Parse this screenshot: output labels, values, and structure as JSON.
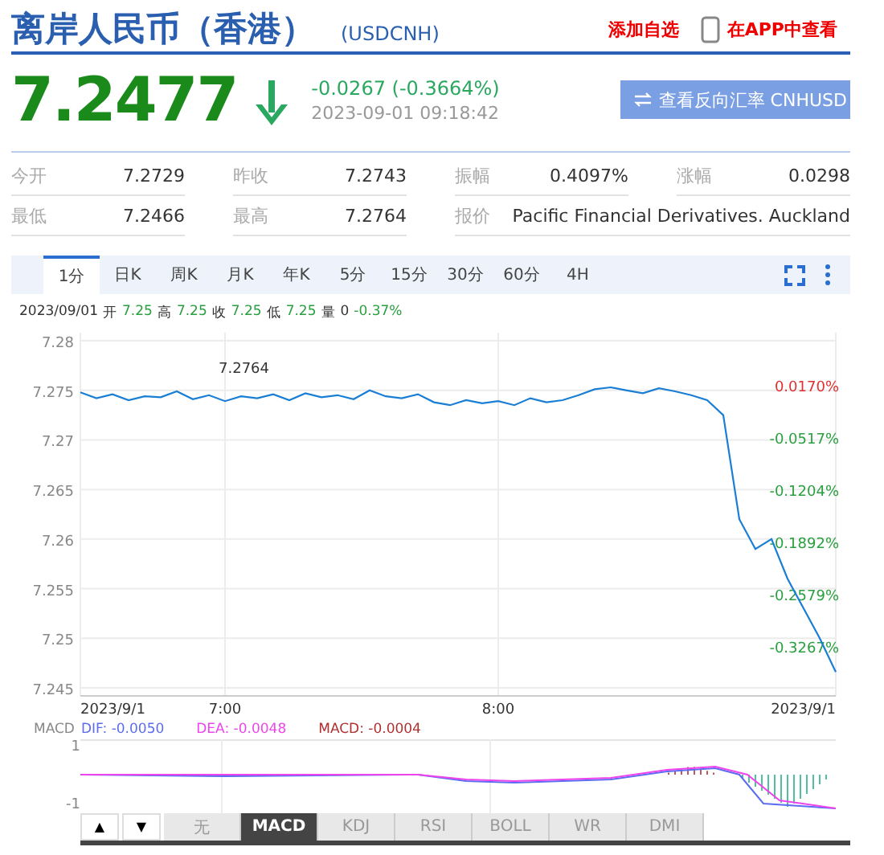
{
  "header": {
    "title": "离岸人民币（香港）",
    "code": "(USDCNH)",
    "add_watch": "添加自选",
    "app_link": "在APP中查看"
  },
  "quote": {
    "price": "7.2477",
    "change": "-0.0267 (-0.3664%)",
    "time": "2023-09-01 09:18:42",
    "reverse_button": "查看反向汇率 CNHUSD"
  },
  "stats": [
    [
      {
        "label": "今开",
        "value": "7.2729"
      },
      {
        "label": "昨收",
        "value": "7.2743"
      },
      {
        "label": "振幅",
        "value": "0.4097%"
      },
      {
        "label": "涨幅",
        "value": "0.0298"
      }
    ],
    [
      {
        "label": "最低",
        "value": "7.2466"
      },
      {
        "label": "最高",
        "value": "7.2764"
      },
      {
        "label": "报价",
        "value": "Pacific Financial Derivatives. Auckland"
      }
    ]
  ],
  "periods": [
    {
      "label": "1分",
      "selected": true
    },
    {
      "label": "日K",
      "selected": false
    },
    {
      "label": "周K",
      "selected": false
    },
    {
      "label": "月K",
      "selected": false
    },
    {
      "label": "年K",
      "selected": false
    },
    {
      "label": "5分",
      "selected": false
    },
    {
      "label": "15分",
      "selected": false
    },
    {
      "label": "30分",
      "selected": false
    },
    {
      "label": "60分",
      "selected": false
    },
    {
      "label": "4H",
      "selected": false
    }
  ],
  "chart": {
    "info": {
      "date": "2023/09/01",
      "fields": [
        {
          "label": "开",
          "value": "7.25"
        },
        {
          "label": "高",
          "value": "7.25"
        },
        {
          "label": "收",
          "value": "7.25"
        },
        {
          "label": "低",
          "value": "7.25"
        },
        {
          "label": "量",
          "value": "0"
        }
      ],
      "change": "-0.37%"
    },
    "percent_labels": [
      "0.0170%",
      "-0.0517%",
      "-0.1204%",
      "-0.1892%",
      "-0.2579%",
      "-0.3267%"
    ],
    "x_labels": [
      "2023/9/1",
      "7:00",
      "8:00",
      "2023/9/1"
    ],
    "high_label": "7.2764",
    "chart_data": {
      "type": "line",
      "grid": true,
      "ylim": [
        7.245,
        7.28
      ],
      "yticks": [
        7.28,
        7.275,
        7.27,
        7.265,
        7.26,
        7.255,
        7.25,
        7.245
      ],
      "series": [
        {
          "color": "#1a7fd4",
          "values": [
            7.2748,
            7.2742,
            7.2746,
            7.274,
            7.2744,
            7.2743,
            7.2749,
            7.2741,
            7.2745,
            7.2739,
            7.2744,
            7.2742,
            7.2746,
            7.274,
            7.2747,
            7.2743,
            7.2745,
            7.2741,
            7.275,
            7.2744,
            7.2742,
            7.2746,
            7.2738,
            7.2735,
            7.274,
            7.2737,
            7.2739,
            7.2735,
            7.2742,
            7.2738,
            7.274,
            7.2745,
            7.2751,
            7.2753,
            7.275,
            7.2747,
            7.2752,
            7.2749,
            7.2745,
            7.274,
            7.2725,
            7.262,
            7.259,
            7.26,
            7.256,
            7.253,
            7.25,
            7.2466
          ]
        }
      ]
    }
  },
  "macd": {
    "name": "MACD",
    "legend": [
      {
        "text": "DIF: -0.0050",
        "color": "#5b6cf0"
      },
      {
        "text": "DEA: -0.0048",
        "color": "#ee44ee"
      },
      {
        "text": "MACD: -0.0004",
        "color": "#b03030"
      }
    ],
    "ticks": [
      "1",
      "-1"
    ]
  },
  "indicator_arrows": [
    "▲",
    "▼"
  ],
  "indicators": [
    {
      "label": "无",
      "selected": false
    },
    {
      "label": "MACD",
      "selected": true
    },
    {
      "label": "KDJ",
      "selected": false
    },
    {
      "label": "RSI",
      "selected": false
    },
    {
      "label": "BOLL",
      "selected": false
    },
    {
      "label": "WR",
      "selected": false
    },
    {
      "label": "DMI",
      "selected": false
    }
  ]
}
